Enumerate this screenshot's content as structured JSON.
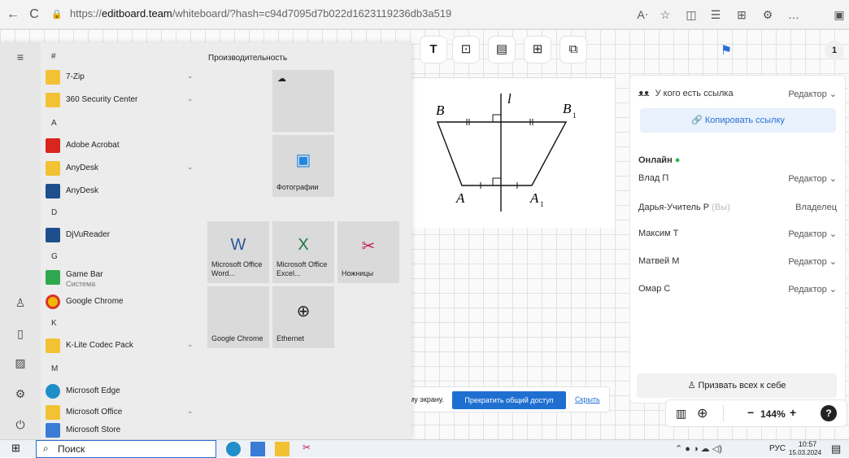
{
  "browser": {
    "url_prefix": "https://",
    "url_domain": "editboard.team",
    "url_path": "/whiteboard/?hash=c94d7095d7b022d1623119236db3a519",
    "back": "←",
    "refresh": "C",
    "lock": "🔒"
  },
  "toolbar": {
    "text_tool": "T"
  },
  "user_count": "1",
  "drawing": {
    "labels": {
      "b": "B",
      "b1": "B",
      "sub1": "1",
      "l": "l",
      "a": "A",
      "a1": "A",
      "sub2": "1"
    }
  },
  "panel": {
    "link_access_label": "У кого есть ссылка",
    "link_access_role": "Редактор ⌄",
    "copy_link": "Копировать ссылку",
    "online_label": "Онлайн",
    "users": [
      {
        "name": "Влад П",
        "you": "",
        "role": "Редактор ⌄"
      },
      {
        "name": "Дарья-Учитель Р",
        "you": "(Вы)",
        "role": "Владелец"
      },
      {
        "name": "Максим Т",
        "you": "",
        "role": "Редактор ⌄"
      },
      {
        "name": "Матвей М",
        "you": "",
        "role": "Редактор ⌄"
      },
      {
        "name": "Омар С",
        "you": "",
        "role": "Редактор ⌄"
      }
    ],
    "call_all": "Призвать всех к себе"
  },
  "zoom": {
    "value": "144%",
    "minus": "−",
    "plus": "+",
    "help": "?"
  },
  "share": {
    "prefix": "му экрану.",
    "stop": "Прекратить общий доступ",
    "hide": "Скрыть"
  },
  "start_menu": {
    "hash_header": "#",
    "productivity_header": "Производительность",
    "apps": [
      {
        "label": "7-Zip",
        "sub": ""
      },
      {
        "label": "360 Security Center",
        "sub": ""
      },
      {
        "label": "Adobe Acrobat",
        "sub": ""
      },
      {
        "label": "AnyDesk",
        "sub": ""
      },
      {
        "label": "AnyDesk",
        "sub": ""
      },
      {
        "label": "DjVuReader",
        "sub": ""
      },
      {
        "label": "Game Bar",
        "sub": "Система"
      },
      {
        "label": "Google Chrome",
        "sub": ""
      },
      {
        "label": "K-Lite Codec Pack",
        "sub": ""
      },
      {
        "label": "Microsoft Edge",
        "sub": ""
      },
      {
        "label": "Microsoft Office",
        "sub": ""
      },
      {
        "label": "Microsoft Store",
        "sub": ""
      }
    ],
    "letters": [
      "A",
      "D",
      "G",
      "K",
      "M"
    ],
    "tiles": {
      "photos": "Фотографии",
      "word": "Microsoft Office Word...",
      "excel": "Microsoft Office Excel...",
      "scissors": "Ножницы",
      "chrome": "Google Chrome",
      "ethernet": "Ethernet"
    }
  },
  "taskbar": {
    "search_placeholder": "Поиск",
    "lang": "РУС",
    "time": "10:57",
    "date": "15.03.2024"
  }
}
